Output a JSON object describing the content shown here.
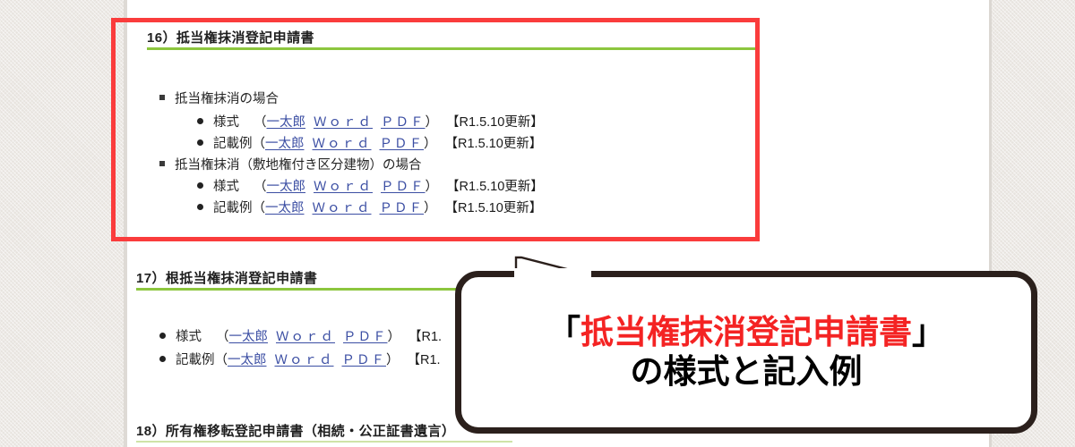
{
  "colors": {
    "highlight_box": "#fa3c3c",
    "section_rule": "#8cc63e",
    "link": "#3b4ea3",
    "bubble_border": "#2b201c",
    "bubble_accent_text": "#f42323",
    "page_background": "#ffffff",
    "desk_background": "#e5e1dc"
  },
  "document": {
    "sections": [
      {
        "number": "16）",
        "title": "抵当権抹消登記申請書",
        "heading": "16）抵当権抹消登記申請書",
        "groups": [
          {
            "label": "抵当権抹消の場合",
            "items": [
              {
                "label": "様式",
                "open_paren": "（",
                "links": [
                  "一太郎",
                  "Ｗｏｒｄ",
                  "ＰＤＦ"
                ],
                "close_paren": "）",
                "note": "【R1.5.10更新】"
              },
              {
                "label": "記載例",
                "open_paren": "（",
                "links": [
                  "一太郎",
                  "Ｗｏｒｄ",
                  "ＰＤＦ"
                ],
                "close_paren": "）",
                "note": "【R1.5.10更新】"
              }
            ]
          },
          {
            "label": "抵当権抹消（敷地権付き区分建物）の場合",
            "items": [
              {
                "label": "様式",
                "open_paren": "（",
                "links": [
                  "一太郎",
                  "Ｗｏｒｄ",
                  "ＰＤＦ"
                ],
                "close_paren": "）",
                "note": "【R1.5.10更新】"
              },
              {
                "label": "記載例",
                "open_paren": "（",
                "links": [
                  "一太郎",
                  "Ｗｏｒｄ",
                  "ＰＤＦ"
                ],
                "close_paren": "）",
                "note": "【R1.5.10更新】"
              }
            ]
          }
        ]
      },
      {
        "number": "17）",
        "title": "根抵当権抹消登記申請書",
        "heading": "17）根抵当権抹消登記申請書",
        "items": [
          {
            "label": "様式",
            "open_paren": "（",
            "links": [
              "一太郎",
              "Ｗｏｒｄ",
              "ＰＤＦ"
            ],
            "close_paren": "）",
            "note": "【R1."
          },
          {
            "label": "記載例",
            "open_paren": "（",
            "links": [
              "一太郎",
              "Ｗｏｒｄ",
              "ＰＤＦ"
            ],
            "close_paren": "）",
            "note": "【R1."
          }
        ]
      },
      {
        "number": "18）",
        "title": "所有権移転登記申請書（相続・公正証書遺言）",
        "heading": "18）所有権移転登記申請書（相続・公正証書遺言）"
      }
    ]
  },
  "callout": {
    "line1_open_bracket": "「",
    "line1_accent": "抵当権抹消登記申請書",
    "line1_close_bracket": "」",
    "line2": "の様式と記入例"
  }
}
